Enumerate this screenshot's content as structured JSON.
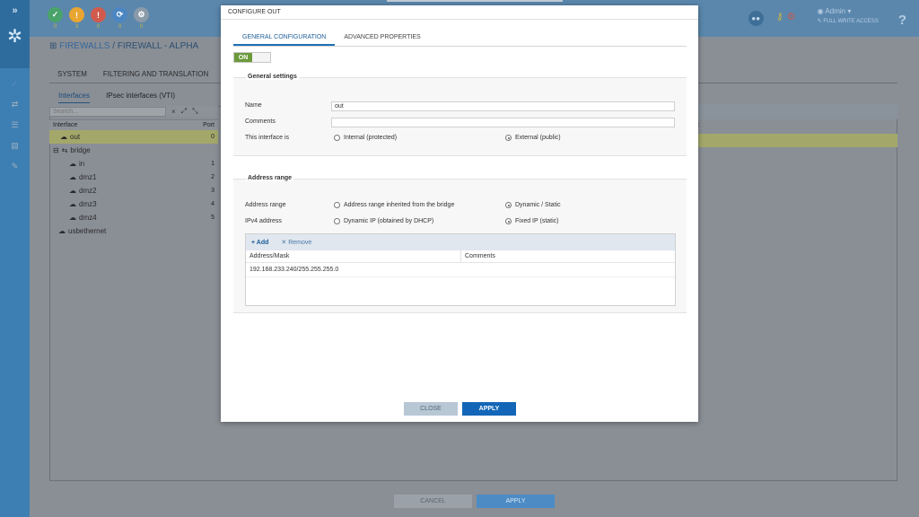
{
  "topbar": {
    "status": [
      {
        "icon": "check-icon",
        "count": "0",
        "color": "#4aa36a"
      },
      {
        "icon": "warning-icon",
        "count": "3",
        "color": "#e8a531"
      },
      {
        "icon": "alert-icon",
        "count": "0",
        "color": "#d05b4c"
      },
      {
        "icon": "refresh-icon",
        "count": "0",
        "color": "#4c86c2"
      },
      {
        "icon": "settings-icon",
        "count": "0",
        "color": "#8a9aa8"
      }
    ],
    "admin_label": "Admin",
    "access_label": "FULL WRITE ACCESS",
    "help": "?"
  },
  "breadcrumb": {
    "link": "FIREWALLS",
    "separator": " / ",
    "current": "FIREWALL - ALPHA"
  },
  "tabs1": [
    "SYSTEM",
    "FILTERING AND TRANSLATION"
  ],
  "tabs2": {
    "active": "Interfaces",
    "other": "IPsec interfaces (VTI)"
  },
  "left_table": {
    "search_placeholder": "Search...",
    "col_interface": "Interface",
    "col_port": "Port",
    "rows": [
      {
        "name": "out",
        "port": "0"
      },
      {
        "name": "bridge",
        "port": ""
      },
      {
        "name": "in",
        "port": "1"
      },
      {
        "name": "dmz1",
        "port": "2"
      },
      {
        "name": "dmz2",
        "port": "3"
      },
      {
        "name": "dmz3",
        "port": "4"
      },
      {
        "name": "dmz4",
        "port": "5"
      },
      {
        "name": "usbethernet",
        "port": ""
      }
    ],
    "right_col_fragment": "nt"
  },
  "bottom": {
    "cancel": "CANCEL",
    "apply": "APPLY"
  },
  "modal": {
    "title": "CONFIGURE OUT",
    "tabs": {
      "general": "GENERAL CONFIGURATION",
      "advanced": "ADVANCED PROPERTIES"
    },
    "toggle": "ON",
    "general": {
      "legend": "General settings",
      "name_label": "Name",
      "name_value": "out",
      "comments_label": "Comments",
      "comments_value": "",
      "interface_label": "This interface is",
      "opt_internal": "Internal (protected)",
      "opt_external": "External (public)"
    },
    "address": {
      "legend": "Address range",
      "range_label": "Address range",
      "opt_inherited": "Address range inherited from the bridge",
      "opt_dynamic_static": "Dynamic / Static",
      "ipv4_label": "IPv4 address",
      "opt_dhcp": "Dynamic IP (obtained by DHCP)",
      "opt_fixed": "Fixed IP (static)",
      "add": "Add",
      "remove": "Remove",
      "col_address": "Address/Mask",
      "col_comments": "Comments",
      "rows": [
        {
          "address": "192.168.233.240/255.255.255.0",
          "comments": ""
        }
      ]
    },
    "close": "CLOSE",
    "apply": "APPLY"
  }
}
